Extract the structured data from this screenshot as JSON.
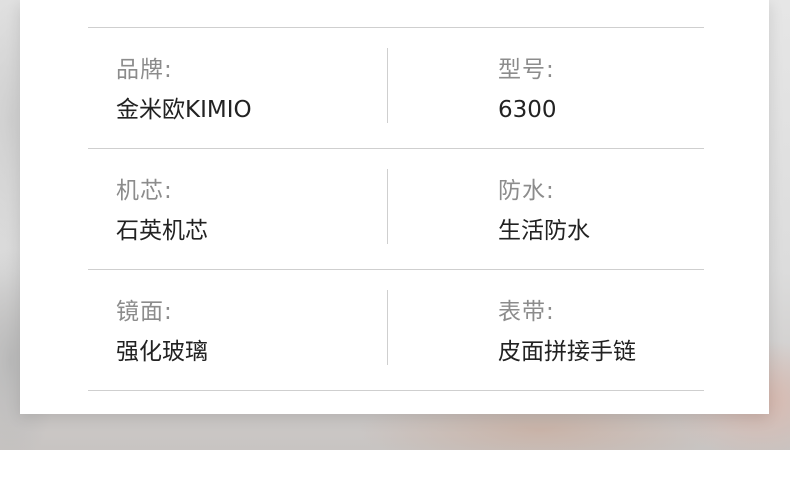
{
  "specs": [
    {
      "left": {
        "label": "品牌:",
        "value": "金米欧KIMIO"
      },
      "right": {
        "label": "型号:",
        "value": "6300"
      }
    },
    {
      "left": {
        "label": "机芯:",
        "value": "石英机芯"
      },
      "right": {
        "label": "防水:",
        "value": "生活防水"
      }
    },
    {
      "left": {
        "label": "镜面:",
        "value": "强化玻璃"
      },
      "right": {
        "label": "表带:",
        "value": "皮面拼接手链"
      }
    }
  ]
}
